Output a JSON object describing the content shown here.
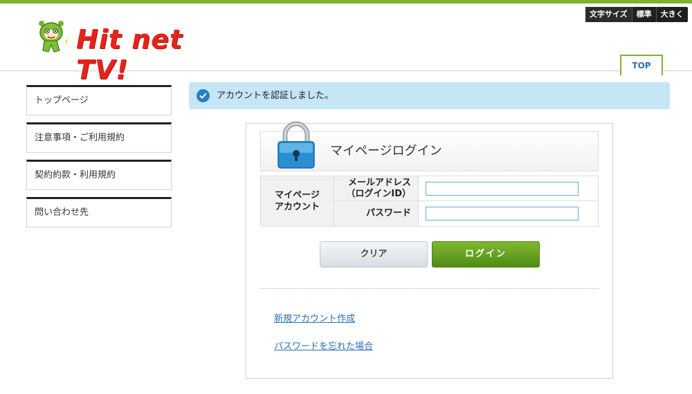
{
  "header": {
    "logo_text": "Hit net TV!",
    "font_size": {
      "label": "文字サイズ",
      "standard": "標準",
      "large": "大きく"
    },
    "top_tab": "TOP"
  },
  "sidebar": {
    "items": [
      {
        "label": "トップページ"
      },
      {
        "label": "注意事項・ご利用規約"
      },
      {
        "label": "契約約款・利用規約"
      },
      {
        "label": "問い合わせ先"
      }
    ]
  },
  "alert": {
    "icon": "check-circle-icon",
    "message": "アカウントを認証しました。"
  },
  "login": {
    "icon": "padlock-icon",
    "title": "マイページログイン",
    "group_label_line1": "マイページ",
    "group_label_line2": "アカウント",
    "email_label_line1": "メールアドレス",
    "email_label_line2": "（ログインID）",
    "email_value": "",
    "password_label": "パスワード",
    "password_value": "",
    "clear_button": "クリア",
    "login_button": "ログイン",
    "links": {
      "create_account": "新規アカウント作成",
      "forgot_password": "パスワードを忘れた場合"
    }
  },
  "colors": {
    "brand_green": "#7ab32e",
    "logo_red": "#e5231b",
    "link_blue": "#2a6fb0",
    "alert_bg": "#c6e6f6"
  }
}
